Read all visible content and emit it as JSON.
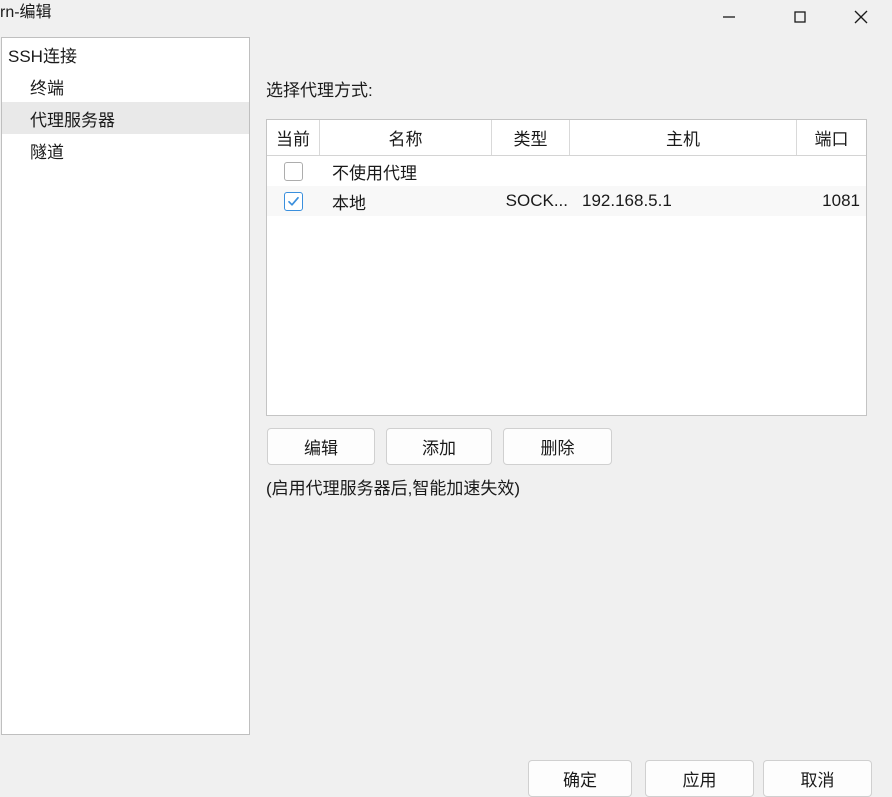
{
  "window": {
    "title": "rn-编辑",
    "controls": [
      {
        "name": "minimize",
        "label": "—"
      },
      {
        "name": "maximize",
        "label": "□"
      },
      {
        "name": "close",
        "label": "✕"
      }
    ],
    "background_color": "#f0f0f0"
  },
  "sidebar": {
    "items": [
      {
        "label": "SSH连接",
        "level": 0,
        "selected": false
      },
      {
        "label": "终端",
        "level": 1,
        "selected": false
      },
      {
        "label": "代理服务器",
        "level": 1,
        "selected": true
      },
      {
        "label": "隧道",
        "level": 1,
        "selected": false
      }
    ],
    "selected_color": "#e9e9e9"
  },
  "main": {
    "section_label": "选择代理方式:",
    "table": {
      "columns": [
        "当前",
        "名称",
        "类型",
        "主机",
        "端口"
      ],
      "rows": [
        {
          "checked": false,
          "name": "不使用代理",
          "type": "",
          "host": "",
          "port": ""
        },
        {
          "checked": true,
          "name": "本地",
          "type": "SOCK...",
          "host": "192.168.5.1",
          "port": "1081"
        }
      ]
    },
    "buttons": {
      "edit": "编辑",
      "add": "添加",
      "delete": "删除"
    },
    "note": "(启用代理服务器后,智能加速失效)"
  },
  "footer": {
    "ok": "确定",
    "apply": "应用",
    "cancel": "取消"
  },
  "colors": {
    "accent": "#3a8fdd",
    "panel": "#ffffff",
    "border": "#c4c4c4",
    "row_alt": "#f8f8f8"
  }
}
